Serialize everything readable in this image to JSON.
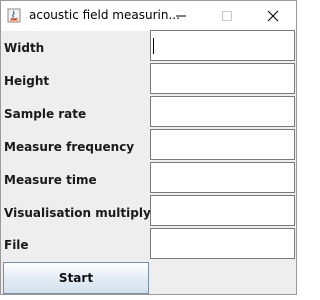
{
  "window": {
    "title": "acoustic field measurin..."
  },
  "form": {
    "rows": [
      {
        "label": "Width",
        "value": ""
      },
      {
        "label": "Height",
        "value": ""
      },
      {
        "label": "Sample rate",
        "value": ""
      },
      {
        "label": "Measure frequency",
        "value": ""
      },
      {
        "label": "Measure time",
        "value": ""
      },
      {
        "label": "Visualisation multiplyer",
        "value": ""
      },
      {
        "label": "File",
        "value": ""
      }
    ],
    "start_label": "Start"
  },
  "icons": {
    "app": "java-app-icon",
    "minimize": "minimize-icon",
    "maximize": "maximize-icon",
    "close": "close-icon"
  }
}
